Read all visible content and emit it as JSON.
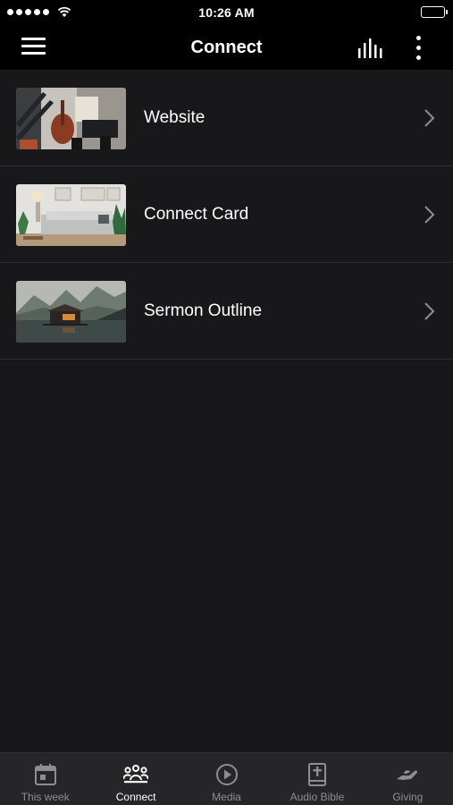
{
  "status_bar": {
    "time": "10:26 AM"
  },
  "nav": {
    "title": "Connect"
  },
  "items": [
    {
      "label": "Website",
      "thumb": "person-with-guitar-photo"
    },
    {
      "label": "Connect Card",
      "thumb": "living-room-photo"
    },
    {
      "label": "Sermon Outline",
      "thumb": "lake-cabin-photo"
    }
  ],
  "tabs": [
    {
      "label": "This week",
      "icon": "calendar-icon",
      "active": false
    },
    {
      "label": "Connect",
      "icon": "people-icon",
      "active": true
    },
    {
      "label": "Media",
      "icon": "play-icon",
      "active": false
    },
    {
      "label": "Audio Bible",
      "icon": "bible-icon",
      "active": false
    },
    {
      "label": "Giving",
      "icon": "giving-hand-icon",
      "active": false
    }
  ],
  "colors": {
    "background": "#18181a",
    "bar": "#000000",
    "tab_bar": "#262628",
    "inactive": "#8d8d92",
    "active": "#ffffff"
  }
}
